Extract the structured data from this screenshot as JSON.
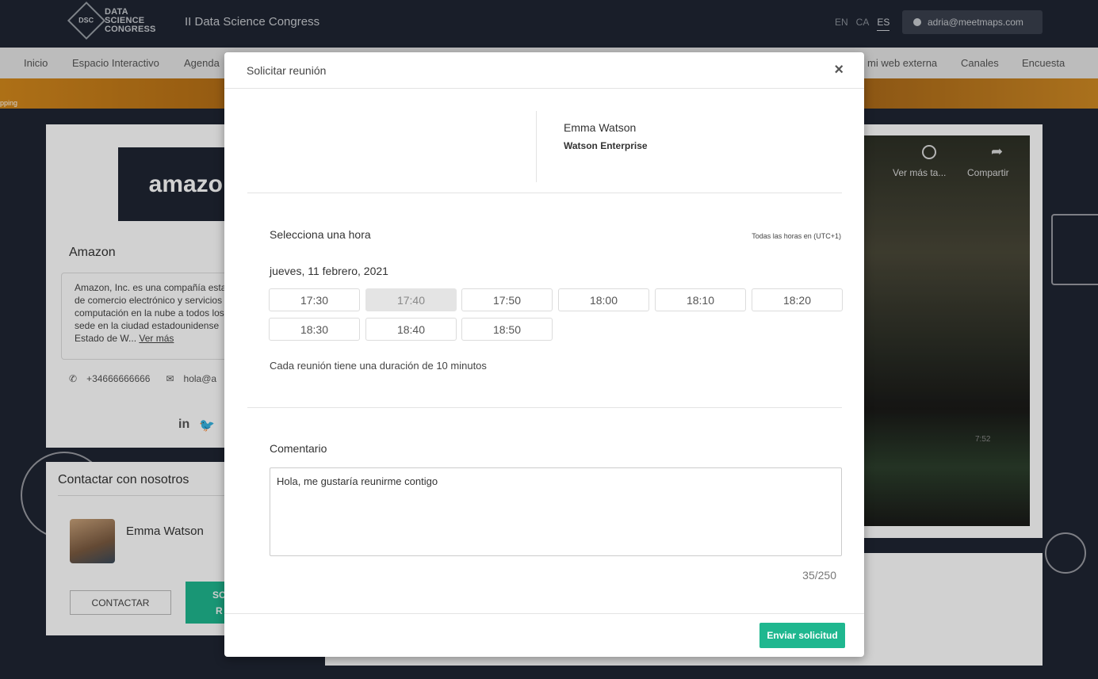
{
  "header": {
    "logo_lines": [
      "DATA",
      "SCIENCE",
      "CONGRESS"
    ],
    "logo_badge": "DSC",
    "event_title": "II Data Science Congress",
    "languages": [
      "EN",
      "CA",
      "ES"
    ],
    "active_language": "ES",
    "user_email": "adria@meetmaps.com"
  },
  "nav": {
    "items": [
      "Inicio",
      "Espacio Interactivo",
      "Agenda",
      "mi web externa",
      "Canales",
      "Encuesta"
    ]
  },
  "banner": {
    "text": "pping"
  },
  "company": {
    "logo_text": "amazon",
    "name": "Amazon",
    "description": "Amazon, Inc. es una compañía esta de comercio electrónico y servicios computación en la nube a todos los sede en la ciudad estadounidense Estado de W...",
    "read_more": "Ver más",
    "phone": "+34666666666",
    "email": "hola@a"
  },
  "social": {
    "linkedin": "in",
    "twitter": "🐦"
  },
  "contact": {
    "title": "Contactar con nosotros",
    "person_name": "Emma Watson",
    "contact_button": "CONTACTAR",
    "partial_button_lines": [
      "SO",
      "R"
    ]
  },
  "video": {
    "watch_later": "Ver más ta...",
    "share": "Compartir",
    "time": "7:52"
  },
  "modal": {
    "title": "Solicitar reunión",
    "close": "×",
    "person_name": "Emma Watson",
    "person_company": "Watson Enterprise",
    "select_title": "Selecciona una hora",
    "timezone_note": "Todas las horas en (UTC+1)",
    "date": "jueves, 11 febrero, 2021",
    "slots": [
      "17:30",
      "17:40",
      "17:50",
      "18:00",
      "18:10",
      "18:20",
      "18:30",
      "18:40",
      "18:50"
    ],
    "selected_slot": "17:40",
    "duration_note": "Cada reunión tiene una duración de 10 minutos",
    "comment_title": "Comentario",
    "comment_value": "Hola, me gustaría reunirme contigo",
    "counter": "35/250",
    "submit": "Enviar solicitud"
  },
  "colors": {
    "background": "#1f2533",
    "accent": "#1fb78f",
    "selected_slot": "#e4e4e4"
  }
}
